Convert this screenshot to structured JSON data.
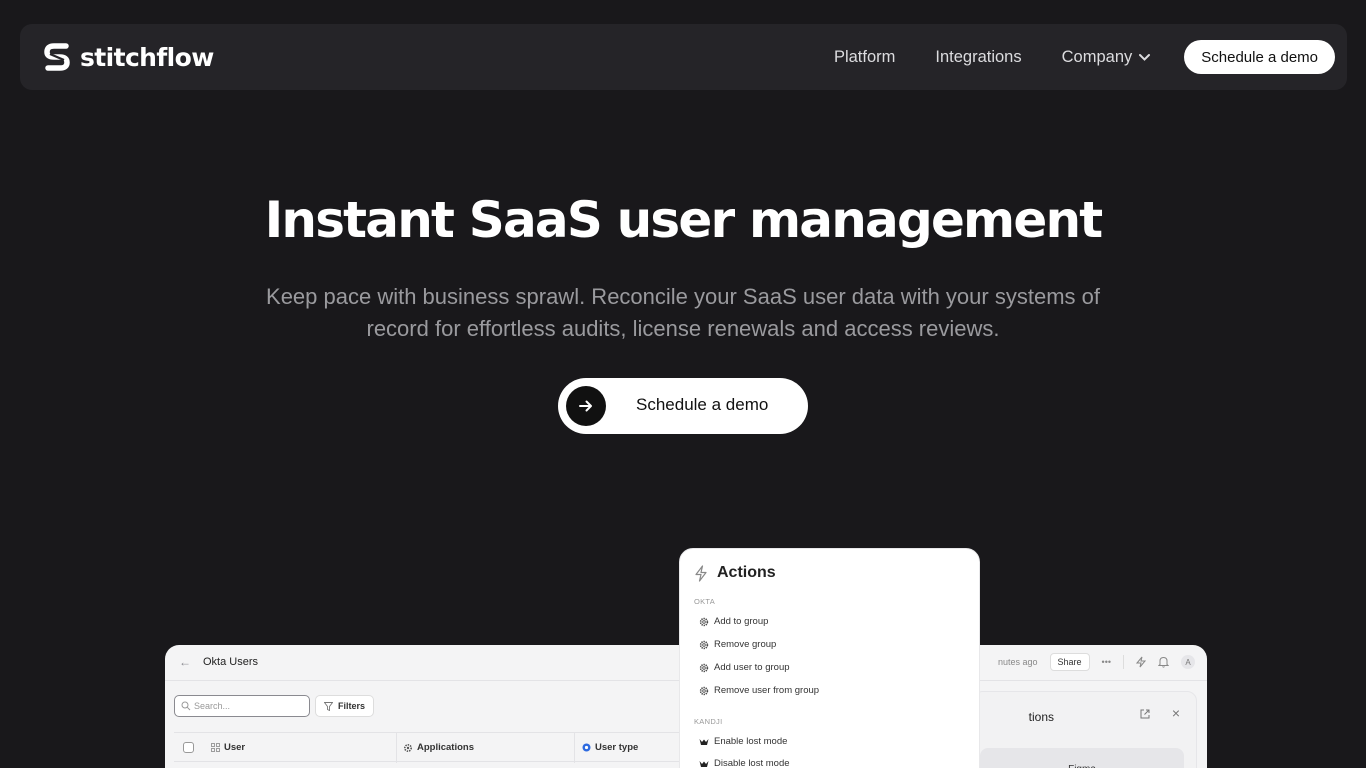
{
  "nav": {
    "brand": "stitchflow",
    "links": [
      {
        "label": "Platform"
      },
      {
        "label": "Integrations"
      },
      {
        "label": "Company"
      }
    ],
    "cta": "Schedule a demo"
  },
  "hero": {
    "title": "Instant SaaS user management",
    "subtitle": "Keep pace with business sprawl. Reconcile your SaaS user data with your systems of record for effortless audits, license renewals and access reviews.",
    "cta": "Schedule a demo"
  },
  "app": {
    "title": "Okta Users",
    "updated": "nutes ago",
    "share": "Share",
    "more": "•••",
    "avatar": "A",
    "search_placeholder": "Search...",
    "filters": "Filters",
    "columns": {
      "user": "User",
      "applications": "Applications",
      "user_type": "User type"
    },
    "panel": {
      "title": "tions",
      "card": "Figma"
    }
  },
  "actions": {
    "title": "Actions",
    "sections": [
      {
        "name": "OKTA",
        "items": [
          "Add to group",
          "Remove group",
          "Add user to group",
          "Remove user from group"
        ]
      },
      {
        "name": "KANDJI",
        "items": [
          "Enable lost mode",
          "Disable lost mode"
        ]
      }
    ]
  },
  "colors": {
    "background": "#19181b",
    "nav": "#252428",
    "accent": "#ffffff"
  }
}
